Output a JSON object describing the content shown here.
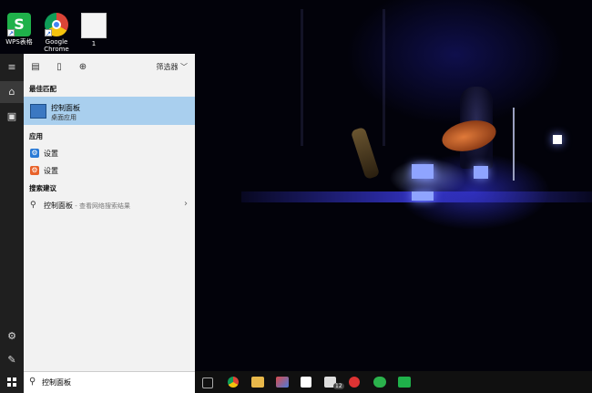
{
  "desktop": {
    "icons": [
      {
        "id": "wps",
        "label": "WPS表格",
        "glyph": "S"
      },
      {
        "id": "chrome",
        "label": "Google Chrome"
      },
      {
        "id": "file",
        "label": "1"
      }
    ]
  },
  "rail": {
    "icons": [
      "hamburger-icon",
      "home-icon",
      "notebook-icon",
      "settings-icon",
      "feedback-icon"
    ]
  },
  "search_panel": {
    "filter_label": "筛选器",
    "best_match_header": "最佳匹配",
    "best_match": {
      "title": "控制面板",
      "subtitle": "桌面应用"
    },
    "apps_header": "应用",
    "apps": [
      {
        "label": "设置"
      },
      {
        "label": "设置"
      }
    ],
    "suggest_header": "搜索建议",
    "suggestion": {
      "text": "控制面板",
      "subtext": " - 查看网络搜索结果"
    }
  },
  "searchbox": {
    "value": "控制面板"
  },
  "taskbar": {
    "badge": "12",
    "apps": [
      "task-view-icon",
      "chrome-icon",
      "file-explorer-icon",
      "paint-icon",
      "store-icon",
      "mail-icon",
      "netease-music-icon",
      "wechat-icon",
      "wps-icon"
    ]
  },
  "colors": {
    "highlight": "#a9cfee",
    "panel_bg": "#f2f2f2",
    "rail_bg": "#1f1f1f",
    "taskbar_bg": "#101010"
  }
}
